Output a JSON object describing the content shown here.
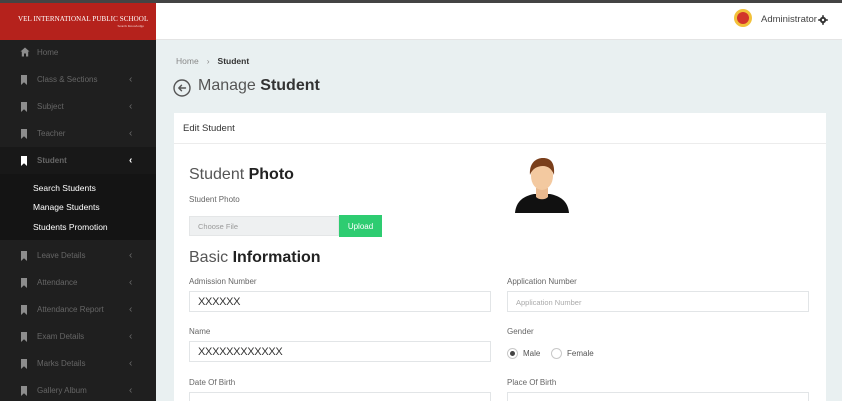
{
  "brand": {
    "title": "VEL INTERNATIONAL PUBLIC SCHOOL",
    "subtitle": "Search Knowledge"
  },
  "sidebar": {
    "items": [
      {
        "label": "Home",
        "icon": "home-icon",
        "chevron": ""
      },
      {
        "label": "Class & Sections",
        "icon": "bookmark-icon",
        "chevron": "‹"
      },
      {
        "label": "Subject",
        "icon": "bookmark-icon",
        "chevron": "‹"
      },
      {
        "label": "Teacher",
        "icon": "bookmark-icon",
        "chevron": "‹"
      },
      {
        "label": "Student",
        "icon": "bookmark-icon",
        "chevron": "‹",
        "active": true
      },
      {
        "label": "Leave Details",
        "icon": "bookmark-icon",
        "chevron": "‹"
      },
      {
        "label": "Attendance",
        "icon": "bookmark-icon",
        "chevron": "‹"
      },
      {
        "label": "Attendance Report",
        "icon": "bookmark-icon",
        "chevron": "‹"
      },
      {
        "label": "Exam Details",
        "icon": "bookmark-icon",
        "chevron": "‹"
      },
      {
        "label": "Marks Details",
        "icon": "bookmark-icon",
        "chevron": "‹"
      },
      {
        "label": "Gallery Album",
        "icon": "bookmark-icon",
        "chevron": "‹"
      }
    ],
    "submenu": [
      "Search Students",
      "Manage Students",
      "Students Promotion"
    ]
  },
  "header": {
    "user": "Administrator"
  },
  "breadcrumb": {
    "home": "Home",
    "separator": "›",
    "current": "Student"
  },
  "page": {
    "title_light": "Manage ",
    "title_bold": "Student"
  },
  "card": {
    "title": "Edit Student",
    "photo_section": {
      "light": "Student ",
      "bold": "Photo"
    },
    "photo_label": "Student Photo",
    "file_placeholder": "Choose File",
    "upload_label": "Upload",
    "info_section": {
      "light": "Basic ",
      "bold": "Information"
    },
    "fields": {
      "admission_number": {
        "label": "Admission Number",
        "value": "XXXXXX"
      },
      "application_number": {
        "label": "Application Number",
        "placeholder": "Application Number"
      },
      "name": {
        "label": "Name",
        "value": "XXXXXXXXXXXX"
      },
      "gender": {
        "label": "Gender",
        "options": [
          "Male",
          "Female"
        ],
        "selected": "Male"
      },
      "dob": {
        "label": "Date Of Birth"
      },
      "pob": {
        "label": "Place Of Birth"
      }
    }
  },
  "colors": {
    "brand_red": "#b5221c",
    "sidebar_bg": "#1f1f1f",
    "upload_green": "#2ecc71"
  }
}
